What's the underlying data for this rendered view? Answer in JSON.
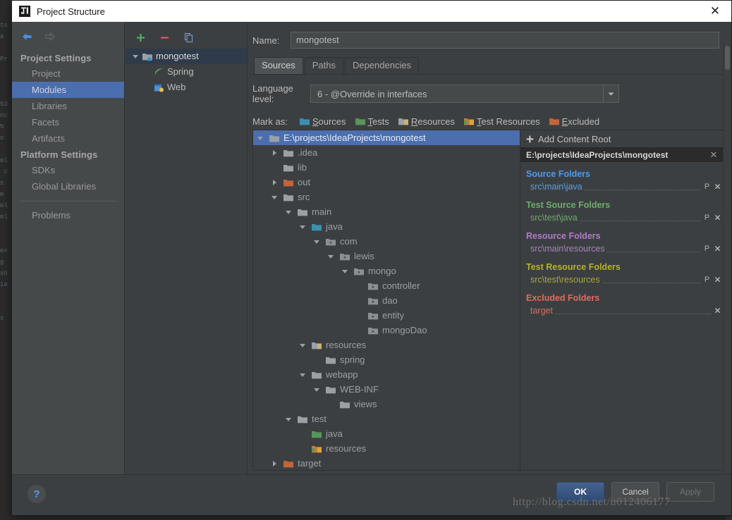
{
  "window": {
    "title": "Project Structure",
    "close_label": "✕",
    "logo_icon": "intellij-logo-icon"
  },
  "sidebar": {
    "nav_back_icon": "arrow-back-icon",
    "nav_forward_icon": "arrow-forward-icon",
    "groups": [
      {
        "title": "Project Settings",
        "items": [
          {
            "label": "Project",
            "selected": false
          },
          {
            "label": "Modules",
            "selected": true
          },
          {
            "label": "Libraries",
            "selected": false
          },
          {
            "label": "Facets",
            "selected": false
          },
          {
            "label": "Artifacts",
            "selected": false
          }
        ]
      },
      {
        "title": "Platform Settings",
        "items": [
          {
            "label": "SDKs",
            "selected": false
          },
          {
            "label": "Global Libraries",
            "selected": false
          }
        ]
      }
    ],
    "problems": {
      "label": "Problems"
    }
  },
  "modules": {
    "toolbar": [
      {
        "name": "add-module-button",
        "icon": "plus-icon",
        "color": "#59a869"
      },
      {
        "name": "remove-module-button",
        "icon": "minus-icon",
        "color": "#db5c5c"
      },
      {
        "name": "copy-module-button",
        "icon": "copy-icon",
        "color": "#7a9ec2"
      }
    ],
    "tree": [
      {
        "label": "mongotest",
        "depth": 0,
        "expanded": true,
        "icon": "module-icon",
        "selected": true
      },
      {
        "label": "Spring",
        "depth": 1,
        "expanded": null,
        "icon": "spring-leaf-icon",
        "selected": false
      },
      {
        "label": "Web",
        "depth": 1,
        "expanded": null,
        "icon": "web-facet-icon",
        "selected": false
      }
    ]
  },
  "editor": {
    "name_label": "Name:",
    "name_value": "mongotest",
    "tabs": [
      {
        "label": "Sources",
        "active": true
      },
      {
        "label": "Paths",
        "active": false
      },
      {
        "label": "Dependencies",
        "active": false
      }
    ],
    "language_level_label": "Language level:",
    "language_level_value": "6 - @Override in interfaces",
    "mark_as_label": "Mark as:",
    "mark_as": [
      {
        "label": "Sources",
        "color": "#3d8fb0",
        "icon": "folder-sources-icon"
      },
      {
        "label": "Tests",
        "color": "#57965c",
        "icon": "folder-tests-icon"
      },
      {
        "label": "Resources",
        "color": "#9aa0a6",
        "icon": "folder-resources-icon"
      },
      {
        "label": "Test Resources",
        "color": "#c87a34",
        "icon": "folder-test-resources-icon"
      },
      {
        "label": "Excluded",
        "color": "#c2653a",
        "icon": "folder-excluded-icon"
      }
    ]
  },
  "content_tree": [
    {
      "label": "E:\\projects\\IdeaProjects\\mongotest",
      "depth": 0,
      "twisty": "down",
      "icon": "folder-plain-icon",
      "selected": true
    },
    {
      "label": ".idea",
      "depth": 1,
      "twisty": "right",
      "icon": "folder-plain-icon",
      "selected": false
    },
    {
      "label": "lib",
      "depth": 1,
      "twisty": "none",
      "icon": "folder-plain-icon",
      "selected": false
    },
    {
      "label": "out",
      "depth": 1,
      "twisty": "right",
      "icon": "folder-excluded-icon",
      "selected": false
    },
    {
      "label": "src",
      "depth": 1,
      "twisty": "down",
      "icon": "folder-plain-icon",
      "selected": false
    },
    {
      "label": "main",
      "depth": 2,
      "twisty": "down",
      "icon": "folder-plain-icon",
      "selected": false
    },
    {
      "label": "java",
      "depth": 3,
      "twisty": "down",
      "icon": "folder-sources-icon",
      "selected": false
    },
    {
      "label": "com",
      "depth": 4,
      "twisty": "down",
      "icon": "folder-package-icon",
      "selected": false
    },
    {
      "label": "lewis",
      "depth": 5,
      "twisty": "down",
      "icon": "folder-package-icon",
      "selected": false
    },
    {
      "label": "mongo",
      "depth": 6,
      "twisty": "down",
      "icon": "folder-package-icon",
      "selected": false
    },
    {
      "label": "controller",
      "depth": 7,
      "twisty": "none",
      "icon": "folder-package-icon",
      "selected": false
    },
    {
      "label": "dao",
      "depth": 7,
      "twisty": "none",
      "icon": "folder-package-icon",
      "selected": false
    },
    {
      "label": "entity",
      "depth": 7,
      "twisty": "none",
      "icon": "folder-package-icon",
      "selected": false
    },
    {
      "label": "mongoDao",
      "depth": 7,
      "twisty": "none",
      "icon": "folder-package-icon",
      "selected": false
    },
    {
      "label": "resources",
      "depth": 3,
      "twisty": "down",
      "icon": "folder-resources-icon",
      "selected": false
    },
    {
      "label": "spring",
      "depth": 4,
      "twisty": "none",
      "icon": "folder-plain-icon",
      "selected": false
    },
    {
      "label": "webapp",
      "depth": 3,
      "twisty": "down",
      "icon": "folder-plain-icon",
      "selected": false
    },
    {
      "label": "WEB-INF",
      "depth": 4,
      "twisty": "down",
      "icon": "folder-plain-icon",
      "selected": false
    },
    {
      "label": "views",
      "depth": 5,
      "twisty": "none",
      "icon": "folder-plain-icon",
      "selected": false
    },
    {
      "label": "test",
      "depth": 2,
      "twisty": "down",
      "icon": "folder-plain-icon",
      "selected": false
    },
    {
      "label": "java",
      "depth": 3,
      "twisty": "none",
      "icon": "folder-tests-icon",
      "selected": false
    },
    {
      "label": "resources",
      "depth": 3,
      "twisty": "none",
      "icon": "folder-test-resources-icon",
      "selected": false
    },
    {
      "label": "target",
      "depth": 1,
      "twisty": "right",
      "icon": "folder-excluded-icon",
      "selected": false
    }
  ],
  "right_pane": {
    "add_content_root": "Add Content Root",
    "root_path": "E:\\projects\\IdeaProjects\\mongotest",
    "root_close": "✕",
    "sections": [
      {
        "title": "Source Folders",
        "color": "#4e9bf0",
        "path_color": "#5b9fe0",
        "paths": [
          {
            "path": "src\\main\\java",
            "has_properties": true
          }
        ]
      },
      {
        "title": "Test Source Folders",
        "color": "#6cae6c",
        "path_color": "#6fa86f",
        "paths": [
          {
            "path": "src\\test\\java",
            "has_properties": true
          }
        ]
      },
      {
        "title": "Resource Folders",
        "color": "#b07cc6",
        "path_color": "#a883b8",
        "paths": [
          {
            "path": "src\\main\\resources",
            "has_properties": true
          }
        ]
      },
      {
        "title": "Test Resource Folders",
        "color": "#b5b32b",
        "path_color": "#a9a73a",
        "paths": [
          {
            "path": "src\\test\\resources",
            "has_properties": true
          }
        ]
      },
      {
        "title": "Excluded Folders",
        "color": "#e06c5e",
        "path_color": "#cf7264",
        "paths": [
          {
            "path": "target",
            "has_properties": false
          }
        ]
      }
    ],
    "properties_icon": "properties-icon",
    "remove_icon": "remove-x-icon"
  },
  "footer": {
    "help_label": "?",
    "buttons": [
      {
        "label": "OK",
        "style": "primary",
        "name": "ok-button"
      },
      {
        "label": "Cancel",
        "style": "normal",
        "name": "cancel-button"
      },
      {
        "label": "Apply",
        "style": "disabled",
        "name": "apply-button"
      }
    ]
  },
  "watermark": "http://blog.csdn.net/u012406177",
  "colors": {
    "accent": "#4b6eaf",
    "dialog_bg": "#3c3f41",
    "sidebar_bg": "#45494a",
    "title_bg": "#ffffff"
  }
}
